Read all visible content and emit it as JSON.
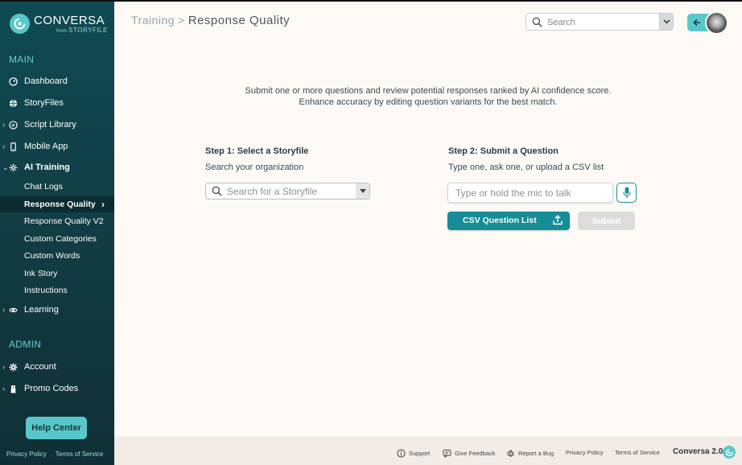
{
  "brand": {
    "name": "CONVERSA",
    "from": "from",
    "sub": "STORYFILE"
  },
  "sidebar": {
    "main_title": "MAIN",
    "items": [
      {
        "label": "Dashboard",
        "icon": "dashboard-icon"
      },
      {
        "label": "StoryFiles",
        "icon": "globe-icon"
      },
      {
        "label": "Script Library",
        "icon": "script-icon"
      },
      {
        "label": "Mobile App",
        "icon": "mobile-icon"
      },
      {
        "label": "AI Training",
        "icon": "sparkle-icon"
      }
    ],
    "ai_training_sub": [
      "Chat Logs",
      "Response Quality",
      "Response Quality V2",
      "Custom Categories",
      "Custom Words",
      "Ink Story",
      "Instructions"
    ],
    "learning": "Learning",
    "admin_title": "ADMIN",
    "admin_items": [
      "Account",
      "Promo Codes"
    ],
    "help_center": "Help Center",
    "privacy": "Privacy Policy",
    "dot": ".",
    "terms": "Terms of Service"
  },
  "header": {
    "crumb_parent": "Training",
    "crumb_sep": ">",
    "crumb_current": "Response Quality",
    "search_placeholder": "Search"
  },
  "main": {
    "intro_line1": "Submit one or more questions and review potential responses ranked by AI confidence score.",
    "intro_line2": "Enhance accuracy by editing question variants for the best match.",
    "step1_title": "Step 1: Select a Storyfile",
    "step1_sub": "Search your organization",
    "step1_placeholder": "Search for a Storyfile",
    "step2_title": "Step 2: Submit a Question",
    "step2_sub": "Type one, ask one, or upload a CSV list",
    "step2_placeholder": "Type or hold the mic to talk",
    "csv_label": "CSV Question List",
    "submit_label": "Submit"
  },
  "footer": {
    "support": "Support",
    "feedback": "Give Feedback",
    "bug": "Report a Bug",
    "privacy": "Privacy Policy",
    "terms": "Terms of Service",
    "brand": "Conversa 2.0"
  },
  "colors": {
    "accent": "#58c7c9",
    "primary_button": "#168c96",
    "sidebar": "#0f4a52"
  }
}
